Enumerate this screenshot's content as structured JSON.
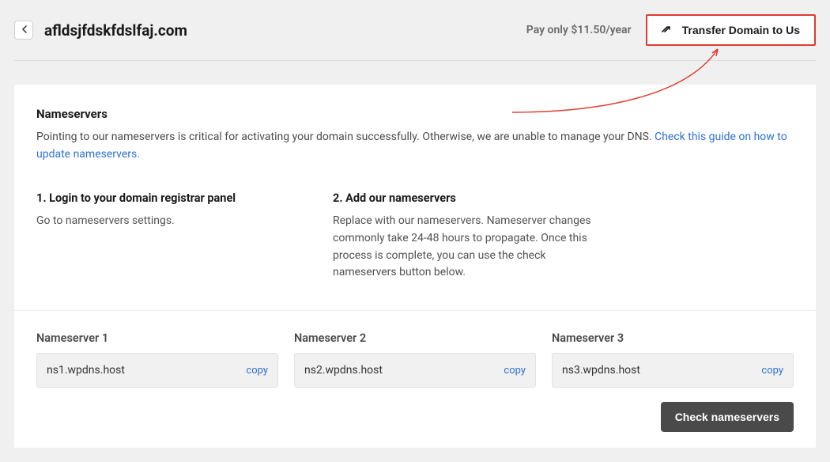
{
  "header": {
    "domain": "afldsjfdskfdslfaj.com",
    "price_text": "Pay only $11.50/year",
    "transfer_btn": "Transfer Domain to Us"
  },
  "ns_section": {
    "title": "Nameservers",
    "description": "Pointing to our nameservers is critical for activating your domain successfully. Otherwise, we are unable to manage your DNS. ",
    "link_text": "Check this guide on how to update nameservers."
  },
  "steps": [
    {
      "title": "1. Login to your domain registrar panel",
      "body": "Go to nameservers settings."
    },
    {
      "title": "2. Add our nameservers",
      "body": "Replace with our nameservers. Nameserver changes commonly take 24-48 hours to propagate. Once this process is complete, you can use the check nameservers button below."
    }
  ],
  "nameservers": [
    {
      "label": "Nameserver 1",
      "value": "ns1.wpdns.host",
      "copy": "copy"
    },
    {
      "label": "Nameserver 2",
      "value": "ns2.wpdns.host",
      "copy": "copy"
    },
    {
      "label": "Nameserver 3",
      "value": "ns3.wpdns.host",
      "copy": "copy"
    }
  ],
  "check_btn": "Check nameservers"
}
